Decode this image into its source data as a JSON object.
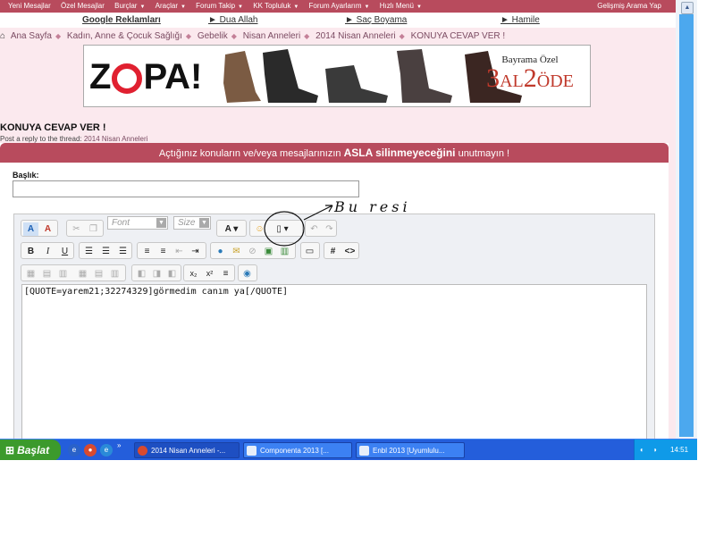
{
  "topnav": {
    "items": [
      {
        "label": "Yeni Mesajlar",
        "dropdown": false
      },
      {
        "label": "Özel Mesajlar",
        "dropdown": false
      },
      {
        "label": "Burçlar",
        "dropdown": true
      },
      {
        "label": "Araçlar",
        "dropdown": true
      },
      {
        "label": "Forum Takip",
        "dropdown": true
      },
      {
        "label": "KK Topluluk",
        "dropdown": true
      },
      {
        "label": "Forum Ayarlarım",
        "dropdown": true
      },
      {
        "label": "Hızlı Menü",
        "dropdown": true
      }
    ],
    "advanced_search": "Gelişmiş Arama Yap"
  },
  "linkbar": {
    "google_ads": "Google Reklamları",
    "links": [
      "► Dua Allah",
      "► Saç Boyama",
      "► Hamile"
    ]
  },
  "breadcrumbs": [
    "Ana Sayfa",
    "Kadın, Anne & Çocuk Sağlığı",
    "Gebelik",
    "Nisan Anneleri",
    "2014 Nisan Anneleri",
    "KONUYA CEVAP VER !"
  ],
  "banner": {
    "brand_left": "Z",
    "brand_rest": "PA!",
    "promo_line1": "Bayrama Özel",
    "promo_big_3": "3",
    "promo_al": "AL",
    "promo_big_2": "2",
    "promo_ode": "ÖDE"
  },
  "thread": {
    "title": "KONUYA CEVAP VER !",
    "subtitle_prefix": "Post a reply to the thread:",
    "subtitle_link": "2014 Nisan Anneleri"
  },
  "warning": {
    "part1": "Açtığınız konuların ve/veya mesajlarınızın ",
    "strong1": "ASLA silinmeyeceğini",
    "part2": " unutmayın !"
  },
  "form": {
    "title_label": "Başlık:",
    "title_value": "",
    "font_placeholder": "Font",
    "size_placeholder": "Size",
    "message": "[QUOTE=yarem21;32274329]görmedim canım ya[/QUOTE]"
  },
  "annotation": "Bu resi",
  "taskbar": {
    "start": "Başlat",
    "tasks": [
      "2014 Nisan Anneleri -...",
      "Componenta 2013 [...",
      "Enbl 2013 [Uyumlulu..."
    ],
    "clock": "14:51"
  },
  "colors": {
    "accent": "#b84b5d",
    "page_bg": "#fbe9ee",
    "taskbar": "#245edb",
    "start": "#3c9a2c"
  }
}
